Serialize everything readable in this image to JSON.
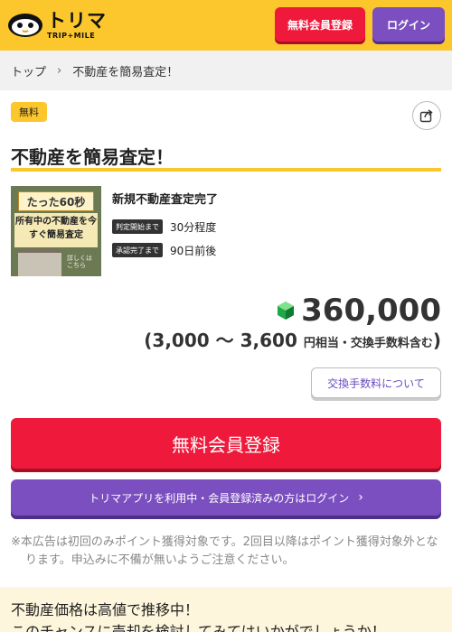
{
  "header": {
    "logo_main": "トリマ",
    "logo_sub": "TRIP+MILE",
    "register_label": "無料会員登録",
    "login_label": "ログイン"
  },
  "breadcrumb": {
    "items": [
      {
        "label": "トップ"
      },
      {
        "label": "不動産を簡易査定！"
      }
    ]
  },
  "offer": {
    "free_tag": "無料",
    "title": "不動産を簡易査定！",
    "image": {
      "banner_text": "たった60秒",
      "main_text": "所有中の不動産を今すぐ簡易査定",
      "note_text": "詳しくはこちら"
    },
    "name": "新規不動産査定完了",
    "rows": [
      {
        "label": "判定開始まで",
        "value": "30分程度"
      },
      {
        "label": "承認完了まで",
        "value": "90日前後"
      }
    ],
    "price": "360,000",
    "price_range_open": "(",
    "price_range": "3,000 〜 3,600",
    "price_range_suffix": "円相当・交換手数料含む",
    "price_range_close": ")",
    "fee_button_label": "交換手数料について",
    "register_button_label": "無料会員登録",
    "login_button_label": "トリマアプリを利用中・会員登録済みの方はログイン",
    "note": "※本広告は初回のみポイント獲得対象です。2回目以降はポイント獲得対象外となります。申込みに不備が無いようご注意ください。"
  },
  "promo": {
    "line1": "不動産価格は高値で推移中！",
    "line2": "このチャンスに売却を検討してみてはいかがでしょうか！"
  },
  "colors": {
    "brand_yellow": "#fcc62d",
    "register_red": "#ef1a3b",
    "login_purple": "#7b4fc0"
  },
  "icons": {
    "share": "share-icon",
    "chevron": "chevron-right-icon",
    "gem": "gem-icon"
  }
}
